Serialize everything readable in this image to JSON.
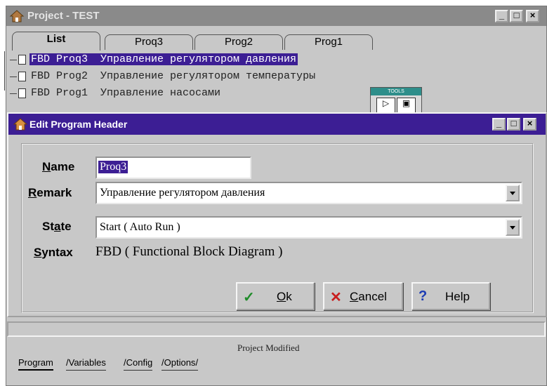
{
  "project_window": {
    "title": "Project - TEST",
    "tabs": [
      {
        "label": "List",
        "active": true
      },
      {
        "label": "Proq3",
        "active": false
      },
      {
        "label": "Prog2",
        "active": false
      },
      {
        "label": "Prog1",
        "active": false
      }
    ],
    "tree": [
      {
        "text": "FBD Proq3  Управление регулятором давления",
        "selected": true
      },
      {
        "text": "FBD Prog2  Управление регулятором температуры",
        "selected": false
      },
      {
        "text": "FBD Prog1  Управление насосами",
        "selected": false
      }
    ],
    "tools_title": "TOOLS",
    "status": "Project Modified",
    "bottom_tabs": [
      {
        "label": "Program",
        "active": true
      },
      {
        "label": "Variables",
        "active": false
      },
      {
        "label": "Config",
        "active": false
      },
      {
        "label": "Options",
        "active": false
      }
    ]
  },
  "dialog": {
    "title": "Edit Program Header",
    "name_label": {
      "accel": "N",
      "rest": "ame"
    },
    "name_value": "Proq3",
    "remark_label": {
      "accel": "R",
      "rest": "emark"
    },
    "remark_value": "Управление регулятором давления",
    "state_label": {
      "pre": "St",
      "accel": "a",
      "rest": "te"
    },
    "state_value": "Start  ( Auto Run )",
    "syntax_label": {
      "accel": "S",
      "rest": "yntax"
    },
    "syntax_value": "FBD ( Functional Block Diagram )",
    "buttons": {
      "ok": {
        "accel": "O",
        "rest": "k"
      },
      "cancel": {
        "accel": "C",
        "rest": "ancel"
      },
      "help": "Help"
    }
  },
  "colors": {
    "title_active": "#3c1e94",
    "title_inactive": "#8a8a8a",
    "face": "#c8c8c8",
    "ok_green": "#1f8c2a",
    "cancel_red": "#c81e1e",
    "help_blue": "#1c3cb4"
  },
  "icons": [
    "house-icon",
    "document-icon",
    "pointer-icon",
    "ok-check-icon",
    "cancel-x-icon",
    "help-question-icon"
  ]
}
